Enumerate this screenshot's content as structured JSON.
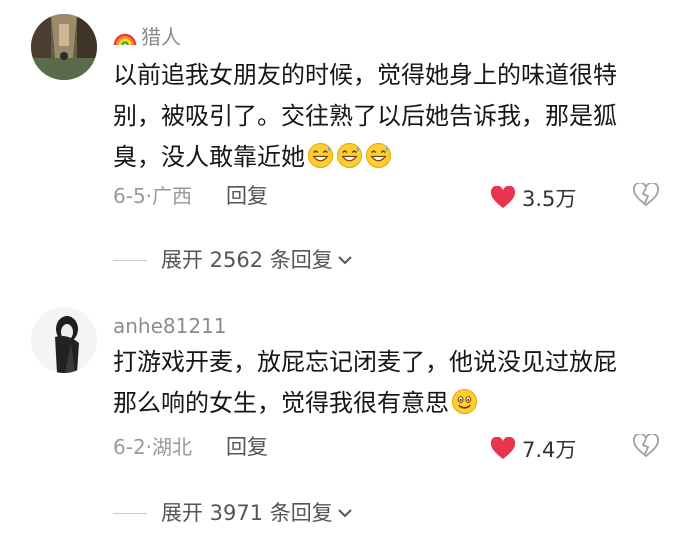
{
  "comments": [
    {
      "username": "猎人",
      "username_icon": "rainbow-icon",
      "text": "以前追我女朋友的时候，觉得她身上的味道很特别，被吸引了。交往熟了以后她告诉我，那是狐臭，没人敢靠近她",
      "emojis": [
        "grinning-sweat-emoji",
        "grinning-sweat-emoji",
        "grinning-sweat-emoji"
      ],
      "date_location": "6-5·广西",
      "reply_label": "回复",
      "likes": "3.5万",
      "expand_label": "展开 2562 条回复"
    },
    {
      "username": "anhe81211",
      "text": "打游戏开麦，放屁忘记闭麦了，他说没见过放屁那么响的女生，觉得我很有意思",
      "emojis": [
        "smiling-face-emoji"
      ],
      "date_location": "6-2·湖北",
      "reply_label": "回复",
      "likes": "7.4万",
      "expand_label": "展开 3971 条回复"
    }
  ],
  "colors": {
    "like_heart": "#e8344f",
    "secondary_text": "#9a9a9a"
  }
}
